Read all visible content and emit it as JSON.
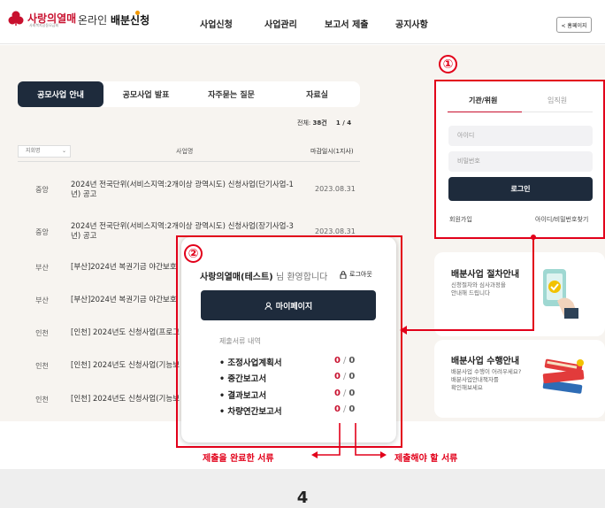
{
  "header": {
    "logo_text": "사랑의열매",
    "logo_sub": "사회복지공동모금회",
    "site_title_prefix": "온라인",
    "site_title_main": "배분신청",
    "nav": [
      "사업신청",
      "사업관리",
      "보고서 제출",
      "공지사항"
    ],
    "home_label": "< 홈페이지"
  },
  "tabs": [
    "공모사업 안내",
    "공모사업 발표",
    "자주묻는 질문",
    "자료실"
  ],
  "list": {
    "count_prefix": "전체:",
    "count_value": "38건",
    "pages": "1 / 4",
    "region_select": "지회명",
    "col_title": "사업명",
    "col_deadline": "마감일시(1지사)",
    "rows": [
      {
        "region": "중앙",
        "title": "2024년 전국단위(서비스지역:2개이상 광역시도) 신청사업(단기사업-1년) 공고",
        "date": "2023.08.31"
      },
      {
        "region": "중앙",
        "title": "2024년 전국단위(서비스지역:2개이상 광역시도) 신청사업(장기사업-3년) 공고",
        "date": "2023.08.31"
      },
      {
        "region": "부산",
        "title": "[부산]2024년 복권기금 야간보호",
        "date": ""
      },
      {
        "region": "부산",
        "title": "[부산]2024년 복권기금 야간보호",
        "date": ""
      },
      {
        "region": "인천",
        "title": "[인천] 2024년도 신청사업(프로그",
        "date": ""
      },
      {
        "region": "인천",
        "title": "[인천] 2024년도 신청사업(기능보",
        "date": ""
      },
      {
        "region": "인천",
        "title": "[인천] 2024년도 신청사업(기능보",
        "date": ""
      }
    ]
  },
  "login": {
    "tab_org": "기관/위원",
    "tab_staff": "임직원",
    "id_placeholder": "아이디",
    "pw_placeholder": "비밀번호",
    "login_button": "로그인",
    "signup": "회원가입",
    "find": "아이디/비밀번호찾기"
  },
  "cards": [
    {
      "title": "배분사업 절차안내",
      "desc_1": "신청절차와 심사과정을",
      "desc_2": "안내해 드립니다"
    },
    {
      "title": "배분사업 수행안내",
      "desc_1": "배분사업 수행이 어려우세요?",
      "desc_2": "배분사업안내책자를",
      "desc_3": "확인해보세요"
    }
  ],
  "markers": {
    "one": "①",
    "two": "②"
  },
  "popup": {
    "user_name": "사랑의열매(테스트)",
    "greeting": "님 환영합니다",
    "logout": "로그아웃",
    "mypage": "마이페이지",
    "doc_heading": "제출서류 내역",
    "docs": [
      {
        "name": "• 조정사업계획서",
        "done": "0",
        "total": "0"
      },
      {
        "name": "• 중간보고서",
        "done": "0",
        "total": "0"
      },
      {
        "name": "• 결과보고서",
        "done": "0",
        "total": "0"
      },
      {
        "name": "• 차량연간보고서",
        "done": "0",
        "total": "0"
      }
    ]
  },
  "annotations": {
    "completed": "제출을 완료한 서류",
    "required": "제출해야 할 서류"
  },
  "page_number": "4",
  "colors": {
    "brand_red": "#c8102e",
    "annotation_red": "#e2001a",
    "navy": "#1e2b3c",
    "background": "#f7f4f0"
  }
}
